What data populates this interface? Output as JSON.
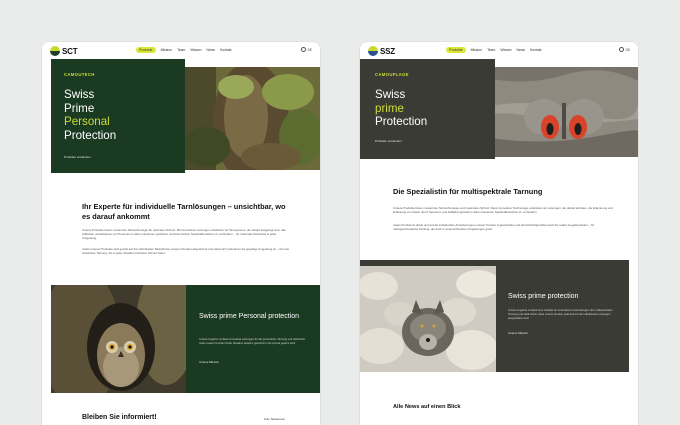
{
  "left": {
    "logo_text": "SCT",
    "nav": [
      "Produkte",
      "Mission",
      "Team",
      "Wissen",
      "News",
      "Kontakt"
    ],
    "lang": "DE",
    "hero": {
      "eyebrow": "CAMOUTECH",
      "title_lines": [
        "Swiss",
        "Prime",
        "Personal",
        "Protection"
      ],
      "link": "Produkte entdecken"
    },
    "intro": {
      "title": "Ihr Experte für individuelle Tarnlösungen – unsichtbar, wo es darauf ankommt",
      "paragraph1": "Unsere Produkte bieten modernste Tarntechnologie für optimalen Schutz. Mit innovativen Lösungen entwickeln wir Tarnsysteme, die darauf ausgelegt sind, das Auffinden und Erfassen von Personen in allen relevanten optischen und thermischen Spektralbereichen zu verhindern – für maximale Sicherheit in jeder Umgebung.",
      "paragraph2": "Jedes unserer Produkte wird gezielt auf die individuellen Bedürfnisse unserer Kunden abgestimmt und passt sich optimal an die jeweilige Umgebung an – für eine zielsichere Tarnung, die in jeder Situation höchsten Schutz bietet."
    },
    "band": {
      "title": "Swiss prime Personal protection",
      "text": "Unsere Angebot umfasst innovative Lösungen für die persönliche Tarnung und Sicherheit. Jede unserer Kunden findet Situation bestens geschützt und optimal getarnt wird.",
      "link": "Unsere Mission"
    },
    "footer": {
      "title": "Bleiben Sie informiert!",
      "link": "Zum Newsroom"
    }
  },
  "right": {
    "logo_text": "SSZ",
    "nav": [
      "Produkte",
      "Mission",
      "Team",
      "Wissen",
      "News",
      "Kontakt"
    ],
    "lang": "DE",
    "hero": {
      "eyebrow": "CAMOUFLAGE",
      "title_lines": [
        "Swiss",
        "prime",
        "Protection"
      ],
      "link": "Produkte entdecken"
    },
    "intro": {
      "title": "Die Spezialistin für multispektrale Tarnung",
      "paragraph1": "Unsere Produkte bieten modernste Tarntechnologie und maximalen Schutz. Dank innovativer Technologie entwickeln wir Lösungen, die darauf abzielen, die Erkennung und Erfassung von Zielen durch Sensoren und Aufklärungsmittel in allen relevanten Spektralbereichen zu verhindern.",
      "paragraph2": "Jedes Produkt ist direkt und auf die individuellen Anforderungen unserer Kunden zugeschnitten und berücksichtigt dabei auch die realen Gegebenheiten – für massgeschneiderte Tarnung, die auch in anspruchsvollen Umgebungen greift."
    },
    "band": {
      "title": "Swiss prime protection",
      "text": "Unsere Angebot umfasst eine Vielzahl an innovativen Anwendungen der multispektralen Tarnung und stellt sicher, dass unsere Kunden jederzeit mit den effektivsten Lösungen ausgestattet sind.",
      "link": "Unsere Mission"
    },
    "footer": {
      "title": "Alle News auf einen Blick"
    }
  },
  "colors": {
    "background": "#e9ecea",
    "left_dark": "#1b3a22",
    "right_dark": "#3a3b35",
    "accent": "#dbe838"
  }
}
